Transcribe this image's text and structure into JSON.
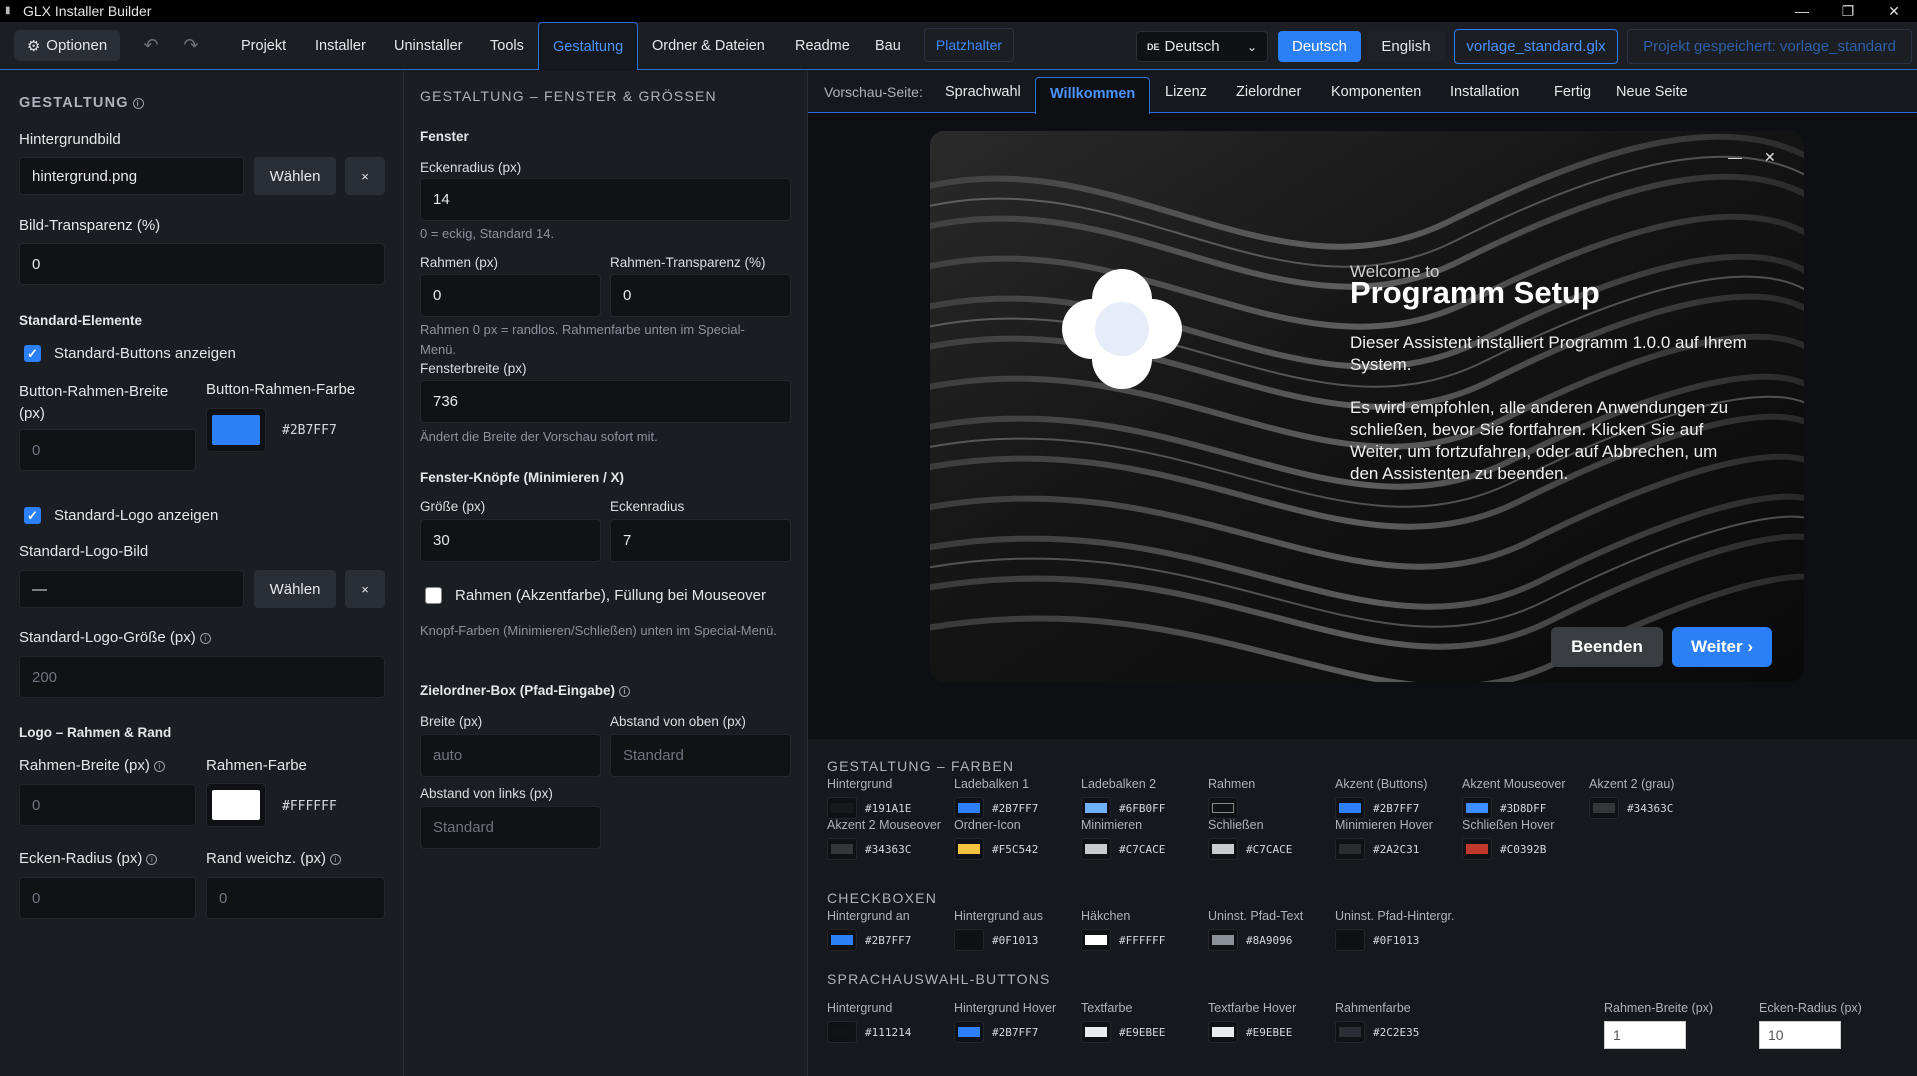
{
  "window": {
    "title": "GLX Installer Builder",
    "min": "—",
    "max": "❐",
    "close": "✕"
  },
  "menubar": {
    "optionen": "Optionen",
    "items": [
      "Projekt",
      "Installer",
      "Uninstaller",
      "Tools",
      "Gestaltung",
      "Ordner & Dateien",
      "Readme",
      "Bau"
    ],
    "active": "Gestaltung",
    "platzhalter": "Platzhalter",
    "language_select": {
      "flag": "DE",
      "value": "Deutsch"
    },
    "btn_deutsch": "Deutsch",
    "btn_english": "English",
    "file": "vorlage_standard.glx",
    "saved": "Projekt gespeichert: vorlage_standard"
  },
  "col1": {
    "title": "GESTALTUNG",
    "hintergrundbild_label": "Hintergrundbild",
    "hintergrundbild_value": "hintergrund.png",
    "waehlen": "Wählen",
    "clear": "×",
    "transparenz_label": "Bild-Transparenz (%)",
    "transparenz_value": "0",
    "std_elemente": "Standard-Elemente",
    "std_buttons": "Standard-Buttons anzeigen",
    "btn_rahmen_breite_label": "Button-Rahmen-Breite (px)",
    "btn_rahmen_breite_value": "0",
    "btn_rahmen_farbe_label": "Button-Rahmen-Farbe",
    "btn_rahmen_farbe_hex": "#2B7FF7",
    "std_logo": "Standard-Logo anzeigen",
    "std_logo_bild_label": "Standard-Logo-Bild",
    "std_logo_bild_value": "—",
    "std_logo_groesse_label": "Standard-Logo-Größe (px)",
    "std_logo_groesse_value": "200",
    "logo_rahmen": "Logo – Rahmen & Rand",
    "rahmen_breite_label": "Rahmen-Breite (px)",
    "rahmen_breite_value": "0",
    "rahmen_farbe_label": "Rahmen-Farbe",
    "rahmen_farbe_hex": "#FFFFFF",
    "ecken_radius_label": "Ecken-Radius (px)",
    "ecken_radius_value": "0",
    "rand_weich_label": "Rand weichz. (px)",
    "rand_weich_value": "0"
  },
  "col2": {
    "title": "GESTALTUNG – FENSTER & GRÖSSEN",
    "fenster": "Fenster",
    "eckenradius_label": "Eckenradius (px)",
    "eckenradius_value": "14",
    "eckenradius_hint": "0 = eckig, Standard 14.",
    "rahmen_label": "Rahmen (px)",
    "rahmen_value": "0",
    "rahmen_transp_label": "Rahmen-Transparenz (%)",
    "rahmen_transp_value": "0",
    "rahmen_hint": "Rahmen 0 px = randlos. Rahmenfarbe unten im Special-Menü.",
    "fensterbreite_label": "Fensterbreite (px)",
    "fensterbreite_value": "736",
    "fensterbreite_hint": "Ändert die Breite der Vorschau sofort mit.",
    "knoepfe": "Fenster-Knöpfe (Minimieren / X)",
    "groesse_label": "Größe (px)",
    "groesse_value": "30",
    "eckenr_label": "Eckenradius",
    "eckenr_value": "7",
    "rahmen_akzent": "Rahmen (Akzentfarbe), Füllung bei Mouseover",
    "knopf_hint": "Knopf-Farben (Minimieren/Schließen) unten im Special-Menü.",
    "zielordner": "Zielordner-Box (Pfad-Eingabe)",
    "breite_label": "Breite (px)",
    "breite_placeholder": "auto",
    "abstand_oben_label": "Abstand von oben (px)",
    "abstand_oben_placeholder": "Standard",
    "abstand_links_label": "Abstand von links (px)",
    "abstand_links_placeholder": "Standard"
  },
  "preview_tabs": {
    "label": "Vorschau-Seite:",
    "items": [
      "Sprachwahl",
      "Willkommen",
      "Lizenz",
      "Zielordner",
      "Komponenten",
      "Installation",
      "Fertig",
      "Neue Seite"
    ],
    "active": "Willkommen"
  },
  "preview": {
    "welcome": "Welcome to",
    "title": "Programm Setup",
    "p1": "Dieser Assistent installiert Programm 1.0.0 auf Ihrem System.",
    "p2": "Es wird empfohlen, alle anderen Anwendungen zu schließen, bevor Sie fortfahren. Klicken Sie auf Weiter, um fortzufahren, oder auf Abbrechen, um den Assistenten zu beenden.",
    "min": "—",
    "close": "✕",
    "beenden": "Beenden",
    "weiter": "Weiter ›"
  },
  "colors": {
    "farben_title": "GESTALTUNG – FARBEN",
    "farben": [
      {
        "label": "Hintergrund",
        "hex": "#191A1E"
      },
      {
        "label": "Ladebalken 1",
        "hex": "#2B7FF7"
      },
      {
        "label": "Ladebalken 2",
        "hex": "#6FB0FF"
      },
      {
        "label": "Rahmen",
        "hex": ""
      },
      {
        "label": "Akzent (Buttons)",
        "hex": "#2B7FF7"
      },
      {
        "label": "Akzent Mouseover",
        "hex": "#3D8DFF"
      },
      {
        "label": "Akzent 2 (grau)",
        "hex": "#34363C"
      },
      {
        "label": "Akzent 2 Mouseover",
        "hex": "#34363C"
      },
      {
        "label": "Ordner-Icon",
        "hex": "#F5C542"
      },
      {
        "label": "Minimieren",
        "hex": "#C7CACE"
      },
      {
        "label": "Schließen",
        "hex": "#C7CACE"
      },
      {
        "label": "Minimieren Hover",
        "hex": "#2A2C31"
      },
      {
        "label": "Schließen Hover",
        "hex": "#C0392B"
      }
    ],
    "checkboxen_title": "CHECKBOXEN",
    "checkboxen": [
      {
        "label": "Hintergrund an",
        "hex": "#2B7FF7"
      },
      {
        "label": "Hintergrund aus",
        "hex": "#0F1013"
      },
      {
        "label": "Häkchen",
        "hex": "#FFFFFF"
      },
      {
        "label": "Uninst. Pfad-Text",
        "hex": "#8A9096"
      },
      {
        "label": "Uninst. Pfad-Hintergr.",
        "hex": "#0F1013"
      }
    ],
    "sprach_title": "SPRACHAUSWAHL-BUTTONS",
    "sprach": [
      {
        "label": "Hintergrund",
        "hex": "#111214"
      },
      {
        "label": "Hintergrund Hover",
        "hex": "#2B7FF7"
      },
      {
        "label": "Textfarbe",
        "hex": "#E9EBEE"
      },
      {
        "label": "Textfarbe Hover",
        "hex": "#E9EBEE"
      },
      {
        "label": "Rahmenfarbe",
        "hex": "#2C2E35"
      }
    ],
    "rahmen_breite_label": "Rahmen-Breite (px)",
    "rahmen_breite_value": "1",
    "ecken_radius_label": "Ecken-Radius (px)",
    "ecken_radius_value": "10"
  }
}
